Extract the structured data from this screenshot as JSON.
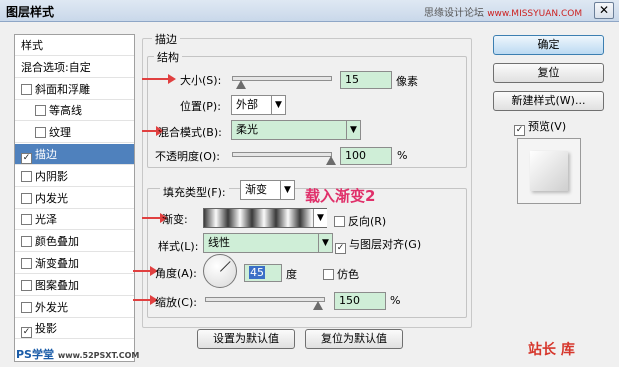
{
  "window": {
    "title": "图层样式",
    "close": "✕"
  },
  "watermark_top": {
    "cn": "思缘设计论坛",
    "url": "www.MISSYUAN.COM"
  },
  "sidebar": {
    "items": [
      {
        "label": "样式",
        "type": "header"
      },
      {
        "label": "混合选项:自定",
        "type": "header"
      },
      {
        "label": "斜面和浮雕",
        "checked": false
      },
      {
        "label": "等高线",
        "checked": false,
        "indent": true
      },
      {
        "label": "纹理",
        "checked": false,
        "indent": true
      },
      {
        "label": "描边",
        "checked": true,
        "selected": true
      },
      {
        "label": "内阴影",
        "checked": false
      },
      {
        "label": "内发光",
        "checked": false
      },
      {
        "label": "光泽",
        "checked": false
      },
      {
        "label": "颜色叠加",
        "checked": false
      },
      {
        "label": "渐变叠加",
        "checked": false
      },
      {
        "label": "图案叠加",
        "checked": false
      },
      {
        "label": "外发光",
        "checked": false
      },
      {
        "label": "投影",
        "checked": true
      }
    ]
  },
  "stroke": {
    "section_title": "描边",
    "structure_title": "结构",
    "size_label": "大小(S):",
    "size_value": "15",
    "size_unit": "像素",
    "position_label": "位置(P):",
    "position_value": "外部",
    "blend_label": "混合模式(B):",
    "blend_value": "柔光",
    "opacity_label": "不透明度(O):",
    "opacity_value": "100",
    "opacity_unit": "%",
    "fill_type_label": "填充类型(F):",
    "fill_type_value": "渐变",
    "annotation": "载入渐变2",
    "gradient_label": "渐变:",
    "reverse_label": "反向(R)",
    "reverse_checked": false,
    "style_label": "样式(L):",
    "style_value": "线性",
    "align_label": "与图层对齐(G)",
    "align_checked": true,
    "angle_label": "角度(A):",
    "angle_value": "45",
    "angle_unit": "度",
    "dither_label": "仿色",
    "dither_checked": false,
    "scale_label": "缩放(C):",
    "scale_value": "150",
    "scale_unit": "%",
    "set_default": "设置为默认值",
    "reset_default": "复位为默认值"
  },
  "right": {
    "ok": "确定",
    "reset": "复位",
    "new_style": "新建样式(W)...",
    "preview_label": "预览(V)",
    "preview_checked": true
  },
  "watermark_bottom": {
    "left": "PS学堂",
    "left_url": "www.52PSXT.COM",
    "right": "站长 库"
  },
  "colors": {
    "selected_row": "#4f81bd",
    "input_bg": "#cfeed7",
    "annotation": "#e0306a",
    "arrow": "#e04040"
  }
}
